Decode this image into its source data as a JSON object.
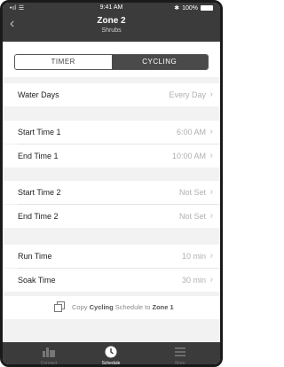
{
  "status_bar": {
    "signal": "•ıl ☰",
    "time": "9:41 AM",
    "bluetooth": "✱",
    "battery": "100%"
  },
  "header": {
    "title": "Zone 2",
    "subtitle": "Shrubs",
    "back_icon": "chevron-left-icon"
  },
  "segments": {
    "timer": "TIMER",
    "cycling": "CYCLING",
    "selected": "cycling"
  },
  "settings": [
    {
      "label": "Water Days",
      "value": "Every Day"
    },
    {
      "label": "Start Time 1",
      "value": "6:00 AM"
    },
    {
      "label": "End Time 1",
      "value": "10:00 AM"
    },
    {
      "label": "Start Time 2",
      "value": "Not Set"
    },
    {
      "label": "End Time 2",
      "value": "Not Set"
    },
    {
      "label": "Run Time",
      "value": "10 min"
    },
    {
      "label": "Soak Time",
      "value": "30 min"
    }
  ],
  "copy_action": {
    "prefix": "Copy",
    "schedule": "Cycling",
    "middle": "Schedule to",
    "zone": "Zone 1"
  },
  "tabs": [
    {
      "label": "Connect",
      "icon": "sprinkler-icon",
      "active": false
    },
    {
      "label": "Schedule",
      "icon": "clock-icon",
      "active": true
    },
    {
      "label": "More",
      "icon": "menu-icon",
      "active": false
    }
  ]
}
